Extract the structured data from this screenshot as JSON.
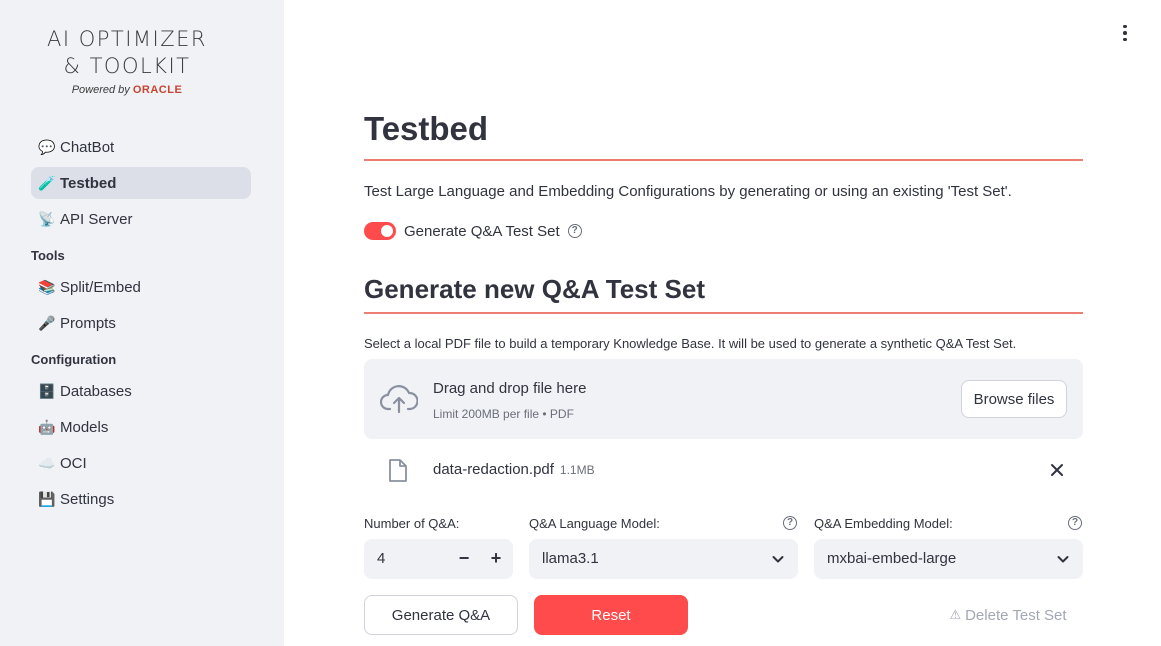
{
  "sidebar": {
    "logo": {
      "line1": "AI OPTIMIZER",
      "line2": "& TOOLKIT",
      "powered_by": "Powered by",
      "brand": "ORACLE"
    },
    "items": [
      {
        "icon": "💬",
        "label": "ChatBot"
      },
      {
        "icon": "🧪",
        "label": "Testbed",
        "active": true
      },
      {
        "icon": "📡",
        "label": "API Server"
      }
    ],
    "tools_heading": "Tools",
    "tools": [
      {
        "icon": "📚",
        "label": "Split/Embed"
      },
      {
        "icon": "🎤",
        "label": "Prompts"
      }
    ],
    "config_heading": "Configuration",
    "config": [
      {
        "icon": "🗄️",
        "label": "Databases"
      },
      {
        "icon": "🤖",
        "label": "Models"
      },
      {
        "icon": "☁️",
        "label": "OCI"
      },
      {
        "icon": "💾",
        "label": "Settings"
      }
    ]
  },
  "main": {
    "title": "Testbed",
    "description": "Test Large Language and Embedding Configurations by generating or using an existing 'Test Set'.",
    "toggle_label": "Generate Q&A Test Set",
    "toggle_on": true,
    "section_title": "Generate new Q&A Test Set",
    "upload_help": "Select a local PDF file to build a temporary Knowledge Base. It will be used to generate a synthetic Q&A Test Set.",
    "dropzone": {
      "title": "Drag and drop file here",
      "subtitle": "Limit 200MB per file • PDF",
      "browse_label": "Browse files"
    },
    "file": {
      "name": "data-redaction.pdf",
      "size": "1.1MB"
    },
    "num_qa": {
      "label": "Number of Q&A:",
      "value": "4",
      "minus": "−",
      "plus": "+"
    },
    "lang_model": {
      "label": "Q&A Language Model:",
      "value": "llama3.1"
    },
    "embed_model": {
      "label": "Q&A Embedding Model:",
      "value": "mxbai-embed-large"
    },
    "buttons": {
      "generate": "Generate Q&A",
      "reset": "Reset",
      "delete": "Delete Test Set",
      "delete_icon": "⚠"
    },
    "help_glyph": "?"
  },
  "colors": {
    "accent": "#ff4b4b",
    "rule": "#ee7d73",
    "sidebar_bg": "#f0f2f6",
    "text": "#31333f",
    "oracle": "#c74634"
  }
}
